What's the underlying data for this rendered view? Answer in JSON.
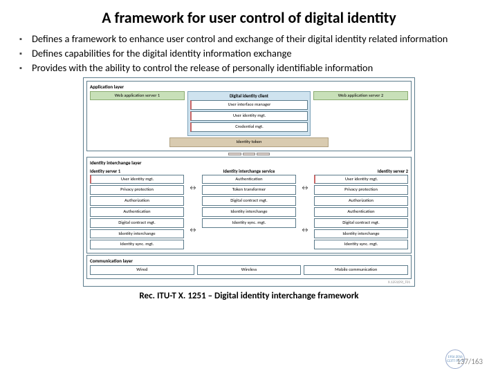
{
  "title": "A framework for user control of digital identity",
  "bullets": [
    "Defines a framework to enhance user control and exchange of their digital identity related information",
    "Defines capabilities for the digital identity information exchange",
    "Provides with the ability to control the release of personally identifiable information"
  ],
  "diagram": {
    "app_layer": {
      "title": "Application layer",
      "left": "Web application server 1",
      "center_title": "Digital identity client",
      "center_boxes": [
        "User interface manager",
        "User identity mgt.",
        "Credential mgt."
      ],
      "right": "Web application server 2",
      "token": "Identity token"
    },
    "interchange_layer": {
      "title": "Identity interchange layer",
      "left_title": "Identity server 1",
      "right_title": "Identity server 2",
      "side_boxes": [
        "User identity mgt.",
        "Privacy protection",
        "Authorization",
        "Authentication",
        "Digital contract mgt.",
        "Identity interchange",
        "Identity sync. mgt."
      ],
      "center_top": "Identity interchange service",
      "center_boxes": [
        "Authentication",
        "Token transformer",
        "Digital contract mgt.",
        "Identity interchange",
        "Identity sync. mgt."
      ]
    },
    "comm_layer": {
      "title": "Communication layer",
      "boxes": [
        "Wired",
        "Wireless",
        "Mobile communication"
      ]
    },
    "credit": "X.1251(09)_F01"
  },
  "caption": "Rec. ITU-T X. 1251 – Digital identity interchange framework",
  "page": "137/163",
  "logo_text": "1956 2016 CCITT ITU-T"
}
